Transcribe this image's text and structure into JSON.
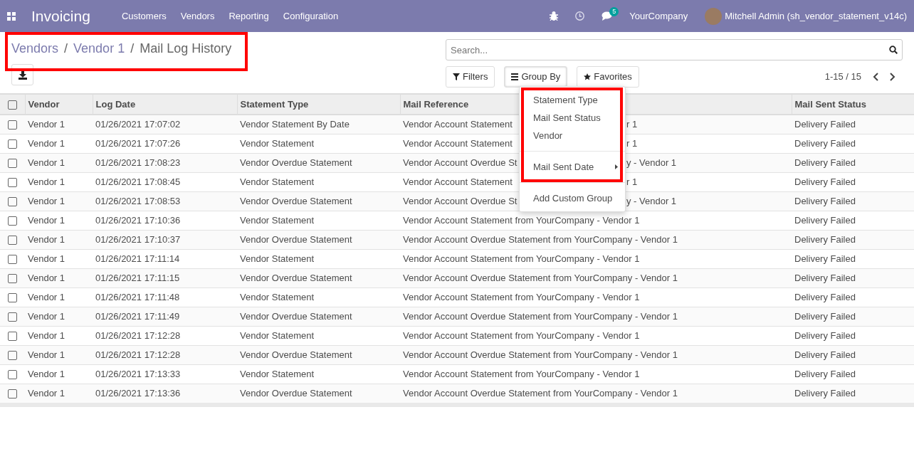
{
  "navbar": {
    "app": "Invoicing",
    "menu": [
      "Customers",
      "Vendors",
      "Reporting",
      "Configuration"
    ],
    "chat_count": "5",
    "company": "YourCompany",
    "user": "Mitchell Admin (sh_vendor_statement_v14c)"
  },
  "breadcrumb": {
    "highlighted": true,
    "items": [
      {
        "label": "Vendors",
        "kind": "link"
      },
      {
        "label": "/",
        "kind": "separator"
      },
      {
        "label": "Vendor 1",
        "kind": "link"
      },
      {
        "label": "/",
        "kind": "separator"
      },
      {
        "label": "Mail Log History",
        "kind": "current"
      }
    ]
  },
  "search": {
    "placeholder": "Search..."
  },
  "filters": [
    {
      "label": "Filters",
      "kind": "filter",
      "open": false
    },
    {
      "label": "Group By",
      "kind": "group",
      "open": true
    },
    {
      "label": "Favorites",
      "kind": "star",
      "open": false
    }
  ],
  "pager": "1-15 / 15",
  "group_by_menu": {
    "highlighted": true,
    "sections": [
      {
        "items": [
          {
            "label": "Statement Type",
            "kind": "option"
          },
          {
            "label": "Mail Sent Status",
            "kind": "option"
          },
          {
            "label": "Vendor",
            "kind": "option"
          }
        ]
      },
      {
        "items": [
          {
            "label": "Mail Sent Date",
            "kind": "submenu"
          }
        ]
      },
      {
        "items": [
          {
            "label": "Add Custom Group",
            "kind": "option"
          }
        ]
      }
    ]
  },
  "table": {
    "select_all": {
      "checked": false
    },
    "columns": [
      "Vendor",
      "Log Date",
      "Statement Type",
      "Mail Reference",
      "Mail Sent Status"
    ],
    "rows": [
      {
        "checked": false,
        "cells": [
          "Vendor 1",
          "01/26/2021 17:07:02",
          "Vendor Statement By Date",
          "Vendor Account Statement",
          "Delivery Failed"
        ],
        "covered_tail": "r 1"
      },
      {
        "checked": false,
        "cells": [
          "Vendor 1",
          "01/26/2021 17:07:26",
          "Vendor Statement",
          "Vendor Account Statement",
          "Delivery Failed"
        ],
        "covered_tail": "r 1"
      },
      {
        "checked": false,
        "cells": [
          "Vendor 1",
          "01/26/2021 17:08:23",
          "Vendor Overdue Statement",
          "Vendor Account Overdue St",
          "Delivery Failed"
        ],
        "covered_tail": "y - Vendor 1"
      },
      {
        "checked": false,
        "cells": [
          "Vendor 1",
          "01/26/2021 17:08:45",
          "Vendor Statement",
          "Vendor Account Statement",
          "Delivery Failed"
        ],
        "covered_tail": "r 1"
      },
      {
        "checked": false,
        "cells": [
          "Vendor 1",
          "01/26/2021 17:08:53",
          "Vendor Overdue Statement",
          "Vendor Account Overdue St",
          "Delivery Failed"
        ],
        "covered_tail": "y - Vendor 1"
      },
      {
        "checked": false,
        "cells": [
          "Vendor 1",
          "01/26/2021 17:10:36",
          "Vendor Statement",
          "Vendor Account Statement from YourCompany - Vendor 1",
          "Delivery Failed"
        ]
      },
      {
        "checked": false,
        "cells": [
          "Vendor 1",
          "01/26/2021 17:10:37",
          "Vendor Overdue Statement",
          "Vendor Account Overdue Statement from YourCompany - Vendor 1",
          "Delivery Failed"
        ]
      },
      {
        "checked": false,
        "cells": [
          "Vendor 1",
          "01/26/2021 17:11:14",
          "Vendor Statement",
          "Vendor Account Statement from YourCompany - Vendor 1",
          "Delivery Failed"
        ]
      },
      {
        "checked": false,
        "cells": [
          "Vendor 1",
          "01/26/2021 17:11:15",
          "Vendor Overdue Statement",
          "Vendor Account Overdue Statement from YourCompany - Vendor 1",
          "Delivery Failed"
        ]
      },
      {
        "checked": false,
        "cells": [
          "Vendor 1",
          "01/26/2021 17:11:48",
          "Vendor Statement",
          "Vendor Account Statement from YourCompany - Vendor 1",
          "Delivery Failed"
        ]
      },
      {
        "checked": false,
        "cells": [
          "Vendor 1",
          "01/26/2021 17:11:49",
          "Vendor Overdue Statement",
          "Vendor Account Overdue Statement from YourCompany - Vendor 1",
          "Delivery Failed"
        ]
      },
      {
        "checked": false,
        "cells": [
          "Vendor 1",
          "01/26/2021 17:12:28",
          "Vendor Statement",
          "Vendor Account Statement from YourCompany - Vendor 1",
          "Delivery Failed"
        ]
      },
      {
        "checked": false,
        "cells": [
          "Vendor 1",
          "01/26/2021 17:12:28",
          "Vendor Overdue Statement",
          "Vendor Account Overdue Statement from YourCompany - Vendor 1",
          "Delivery Failed"
        ]
      },
      {
        "checked": false,
        "cells": [
          "Vendor 1",
          "01/26/2021 17:13:33",
          "Vendor Statement",
          "Vendor Account Statement from YourCompany - Vendor 1",
          "Delivery Failed"
        ]
      },
      {
        "checked": false,
        "cells": [
          "Vendor 1",
          "01/26/2021 17:13:36",
          "Vendor Overdue Statement",
          "Vendor Account Overdue Statement from YourCompany - Vendor 1",
          "Delivery Failed"
        ]
      }
    ]
  }
}
